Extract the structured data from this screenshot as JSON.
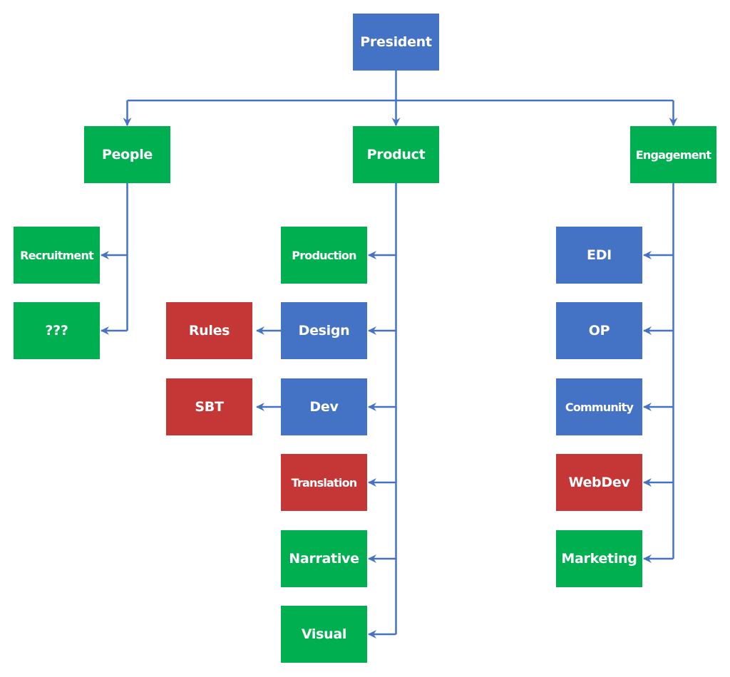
{
  "colors": {
    "blue": "#4472C4",
    "green": "#00B050",
    "red": "#C53636",
    "connector": "#4472C4"
  },
  "nodes": {
    "president": {
      "label": "President",
      "color": "blue"
    },
    "people": {
      "label": "People",
      "color": "green"
    },
    "product": {
      "label": "Product",
      "color": "green"
    },
    "engagement": {
      "label": "Engagement",
      "color": "green"
    },
    "recruitment": {
      "label": "Recruitment",
      "color": "green"
    },
    "unknown": {
      "label": "???",
      "color": "green"
    },
    "production": {
      "label": "Production",
      "color": "green"
    },
    "design": {
      "label": "Design",
      "color": "blue"
    },
    "dev": {
      "label": "Dev",
      "color": "blue"
    },
    "translation": {
      "label": "Translation",
      "color": "red"
    },
    "narrative": {
      "label": "Narrative",
      "color": "green"
    },
    "visual": {
      "label": "Visual",
      "color": "green"
    },
    "rules": {
      "label": "Rules",
      "color": "red"
    },
    "sbt": {
      "label": "SBT",
      "color": "red"
    },
    "edi": {
      "label": "EDI",
      "color": "blue"
    },
    "op": {
      "label": "OP",
      "color": "blue"
    },
    "community": {
      "label": "Community",
      "color": "blue"
    },
    "webdev": {
      "label": "WebDev",
      "color": "red"
    },
    "marketing": {
      "label": "Marketing",
      "color": "green"
    }
  },
  "edges": [
    [
      "president",
      "people"
    ],
    [
      "president",
      "product"
    ],
    [
      "president",
      "engagement"
    ],
    [
      "people",
      "recruitment"
    ],
    [
      "people",
      "unknown"
    ],
    [
      "product",
      "production"
    ],
    [
      "product",
      "design"
    ],
    [
      "product",
      "dev"
    ],
    [
      "product",
      "translation"
    ],
    [
      "product",
      "narrative"
    ],
    [
      "product",
      "visual"
    ],
    [
      "design",
      "rules"
    ],
    [
      "dev",
      "sbt"
    ],
    [
      "engagement",
      "edi"
    ],
    [
      "engagement",
      "op"
    ],
    [
      "engagement",
      "community"
    ],
    [
      "engagement",
      "webdev"
    ],
    [
      "engagement",
      "marketing"
    ]
  ]
}
